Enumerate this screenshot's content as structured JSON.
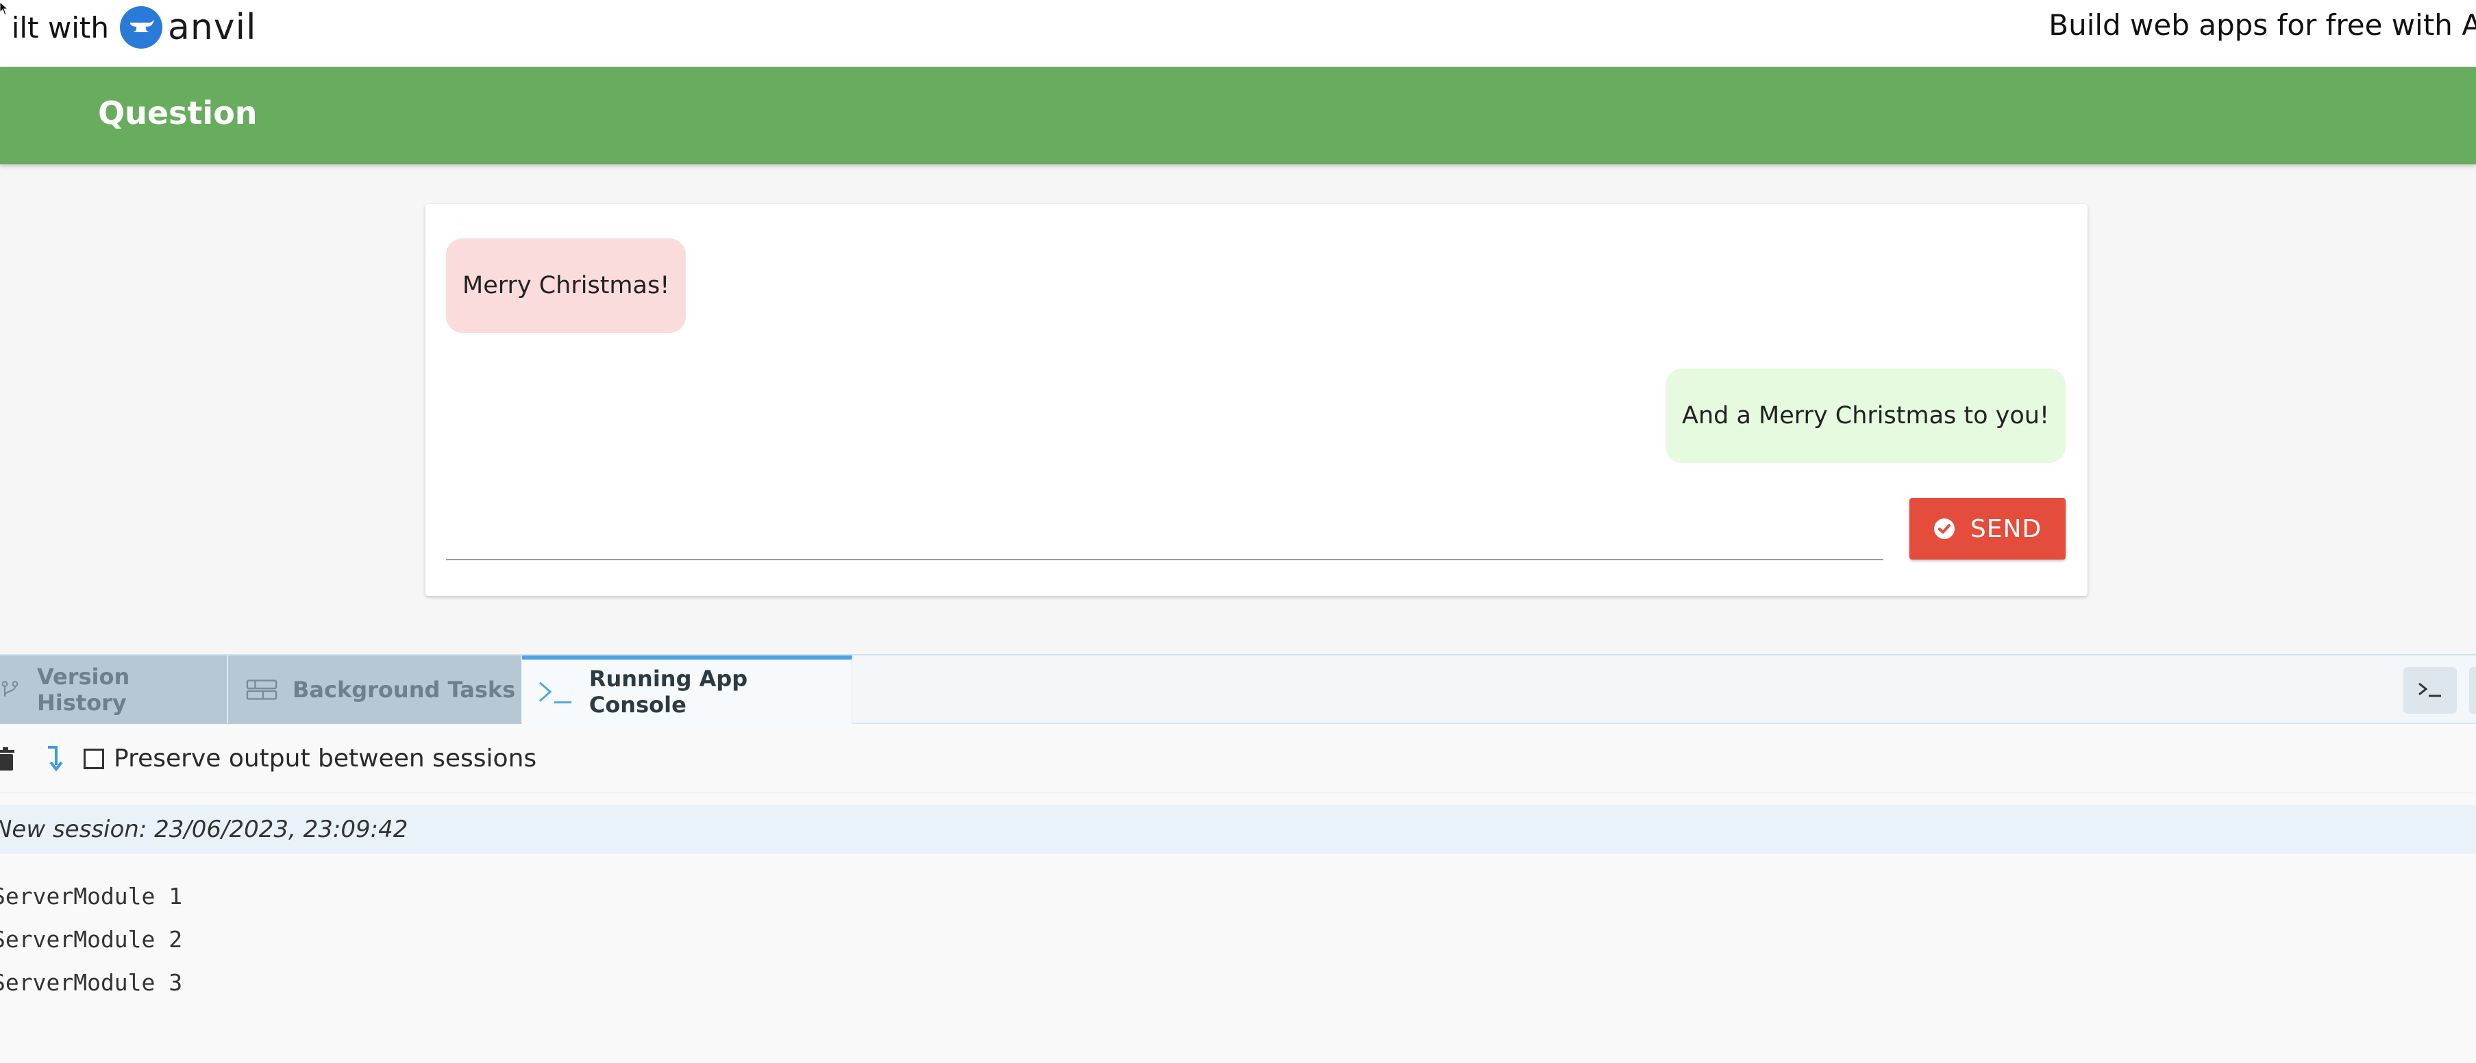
{
  "topbar": {
    "built_with": "  ilt with",
    "brand": "anvil",
    "promo": "Build web apps for free with A"
  },
  "app": {
    "title": "Question",
    "header_color": "#68ad5e"
  },
  "chat": {
    "messages": [
      {
        "side": "incoming",
        "text": "Merry Christmas!",
        "color": "#fadcdc"
      },
      {
        "side": "outgoing",
        "text": "And a Merry Christmas to you!",
        "color": "#e6fae0"
      }
    ],
    "input_value": "",
    "send_label": "SEND",
    "send_color": "#e44d3b",
    "send_icon": "check-circle-icon"
  },
  "panel": {
    "tabs": [
      {
        "label": "Version History",
        "icon": "branch-icon",
        "active": false
      },
      {
        "label": "Background Tasks",
        "icon": "tasks-icon",
        "active": false
      },
      {
        "label": "Running App Console",
        "icon": "terminal-icon",
        "active": true
      }
    ],
    "preserve_label": "Preserve output between sessions",
    "preserve_checked": false,
    "session_header": "New session: 23/06/2023, 23:09:42",
    "output_lines": [
      "ServerModule 1",
      "ServerModule 2",
      "ServerModule 3"
    ],
    "accent_color": "#4ba3e4"
  }
}
